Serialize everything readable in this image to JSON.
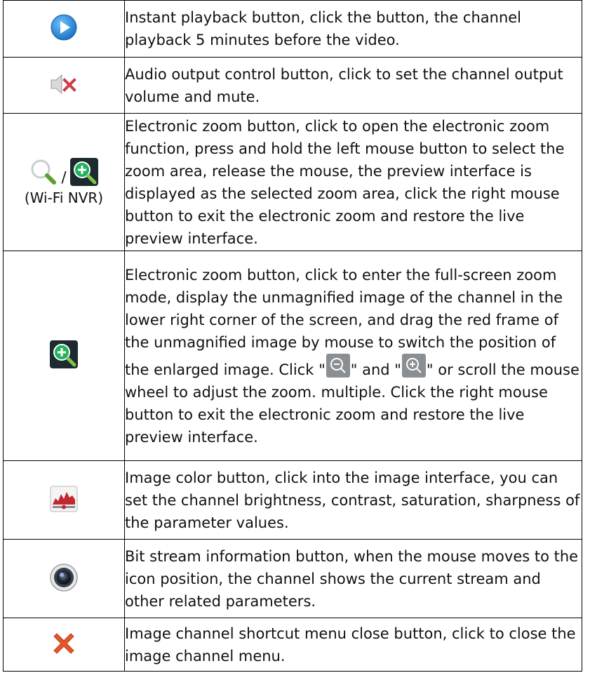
{
  "rows": [
    {
      "icon": "play-circle-icon",
      "text": "Instant playback button, click the button, the channel playback 5 minutes before the video."
    },
    {
      "icon": "speaker-mute-icon",
      "text": "Audio output control button, click to set the channel output volume and mute."
    },
    {
      "icon": "magnifier-icon",
      "icon_alt": "zoom-in-green-icon",
      "separator": "/",
      "sub_label": "(Wi-Fi NVR)",
      "text": "Electronic zoom button, click to open the electronic zoom function, press and hold the left mouse button to select the zoom area, release the mouse, the preview interface is displayed as the selected zoom area, click the right mouse button to exit the electronic zoom and restore the live preview interface."
    },
    {
      "icon": "zoom-in-green-icon",
      "text_part1": "Electronic zoom button, click to enter the full-screen zoom mode, display the unmagnified image of the channel in the lower right corner of the screen, and drag the red frame of the unmagnified image by mouse to switch the position of the enlarged image. Click \"",
      "inline_icon1": "zoom-out-icon",
      "text_part2": "\" and \"",
      "inline_icon2": "zoom-in-icon",
      "text_part3": "\" or scroll the mouse wheel to adjust the zoom. multiple. Click the right mouse button to exit the electronic zoom and restore the live preview interface."
    },
    {
      "icon": "image-color-icon",
      "text": "Image color button, click into the image interface, you can set the channel brightness, contrast, saturation, sharpness of the parameter values."
    },
    {
      "icon": "camera-lens-icon",
      "text": "Bit stream information button, when the mouse moves to the icon position, the channel shows the current stream and other related parameters."
    },
    {
      "icon": "close-x-icon",
      "text": "Image channel shortcut menu close button, click to close the image channel menu."
    }
  ],
  "colors": {
    "play_blue": "#2f8fdc",
    "mute_red": "#e0434b",
    "zoom_green": "#1fa35a",
    "close_orange": "#e8552a",
    "lens_dark": "#3a3f47"
  }
}
